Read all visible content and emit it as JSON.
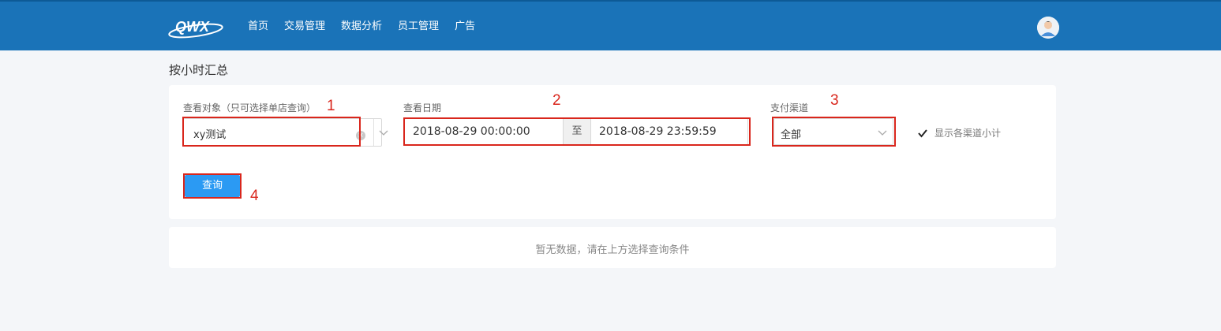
{
  "header": {
    "logo_text": "QWX",
    "nav": [
      "首页",
      "交易管理",
      "数据分析",
      "员工管理",
      "广告"
    ],
    "brand_color": "#1a73b8"
  },
  "page": {
    "title": "按小时汇总"
  },
  "filter": {
    "object_label": "查看对象（只可选择单店查询）",
    "object_value": "xy测试",
    "date_label": "查看日期",
    "date_start": "2018-08-29 00:00:00",
    "date_separator": "至",
    "date_end": "2018-08-29 23:59:59",
    "channel_label": "支付渠道",
    "channel_value": "全部",
    "subtotal_label": "显示各渠道小计",
    "subtotal_checked": true,
    "query_button": "查询"
  },
  "annotations": [
    "1",
    "2",
    "3",
    "4"
  ],
  "annotation_color": "#d9261c",
  "results": {
    "empty_text": "暂无数据，请在上方选择查询条件"
  }
}
